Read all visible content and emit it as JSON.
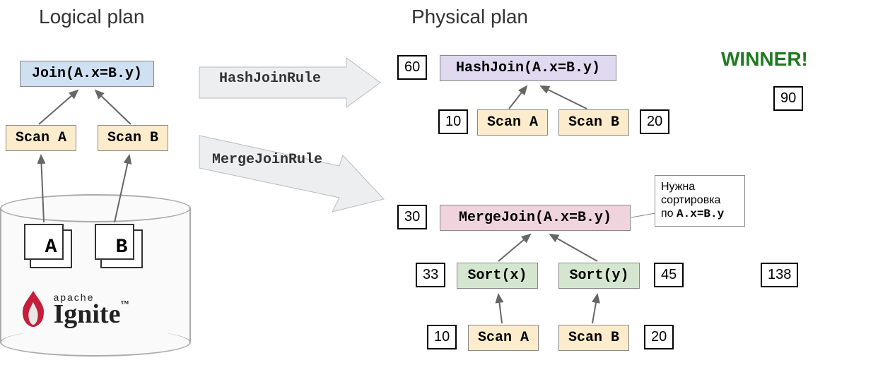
{
  "headings": {
    "logical": "Logical plan",
    "physical": "Physical plan"
  },
  "logical": {
    "join": "Join(A.x=B.y)",
    "scanA": "Scan A",
    "scanB": "Scan B",
    "tableA": "A",
    "tableB": "B",
    "logo_apache": "apache",
    "logo_ignite": "Ignite"
  },
  "rules": {
    "hash": "HashJoinRule",
    "merge": "MergeJoinRule"
  },
  "physical": {
    "hash": {
      "join": "HashJoin(A.x=B.y)",
      "scanA": "Scan A",
      "scanB": "Scan B",
      "cost_join": "60",
      "cost_scanA": "10",
      "cost_scanB": "20",
      "total": "90"
    },
    "merge": {
      "join": "MergeJoin(A.x=B.y)",
      "sortX": "Sort(x)",
      "sortY": "Sort(y)",
      "scanA": "Scan A",
      "scanB": "Scan B",
      "cost_join": "30",
      "cost_sortX": "33",
      "cost_sortY": "45",
      "cost_scanA": "10",
      "cost_scanB": "20",
      "total": "138",
      "note_line1": "Нужна",
      "note_line2": "сортировка",
      "note_line3_prefix": "по ",
      "note_line3_mono": "A.x=B.y"
    },
    "winner": "WINNER!"
  }
}
